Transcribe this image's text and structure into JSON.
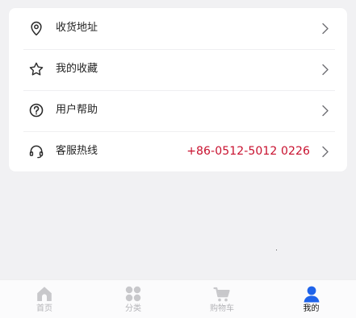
{
  "menu": {
    "items": [
      {
        "icon": "location-pin-icon",
        "label": "收货地址",
        "value": ""
      },
      {
        "icon": "star-icon",
        "label": "我的收藏",
        "value": ""
      },
      {
        "icon": "help-circle-icon",
        "label": "用户帮助",
        "value": ""
      },
      {
        "icon": "headset-icon",
        "label": "客服热线",
        "value": "+86-0512-5012 0226"
      }
    ]
  },
  "tabbar": {
    "tabs": [
      {
        "icon": "home-icon",
        "label": "首页",
        "active": false
      },
      {
        "icon": "category-icon",
        "label": "分类",
        "active": false
      },
      {
        "icon": "cart-icon",
        "label": "购物车",
        "active": false
      },
      {
        "icon": "user-icon",
        "label": "我的",
        "active": true
      }
    ]
  },
  "colors": {
    "page_background": "#f1f1f3",
    "card_background": "#ffffff",
    "hotline_text": "#c8102e",
    "tab_inactive": "#c8c8cb",
    "tab_active": "#1f63ea"
  }
}
